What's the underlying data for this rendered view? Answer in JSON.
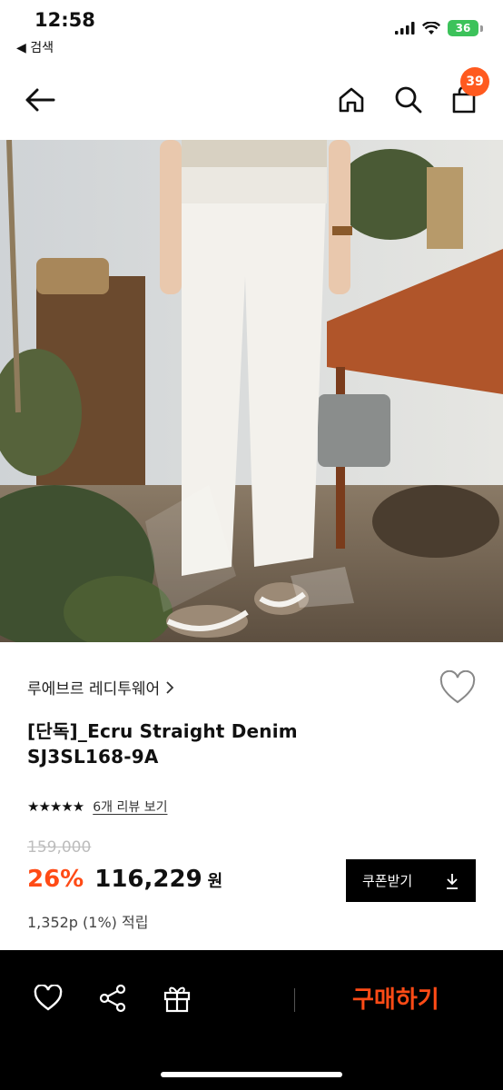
{
  "status_bar": {
    "time": "12:58",
    "back_label": "◀ 검색",
    "battery": "36"
  },
  "header": {
    "cart_count": "39",
    "icons": [
      "back-arrow-icon",
      "home-icon",
      "search-icon",
      "cart-icon"
    ]
  },
  "product": {
    "brand": "루에브르 레디투웨어",
    "title_line1": "[단독]_Ecru Straight Denim",
    "title_line2": "SJ3SL168-9A",
    "rating_stars": "★★★★★",
    "review_link": "6개 리뷰 보기",
    "original_price": "159,000",
    "discount": "26%",
    "price": "116,229",
    "currency": "원",
    "coupon_button": "쿠폰받기",
    "points": "1,352p (1%) 적립"
  },
  "bottom_bar": {
    "buy_label": "구매하기",
    "icons": [
      "heart-icon",
      "share-icon",
      "gift-icon"
    ]
  },
  "colors": {
    "accent": "#ff4b16",
    "badge": "#ff5a1f",
    "battery": "#3cc25a"
  }
}
